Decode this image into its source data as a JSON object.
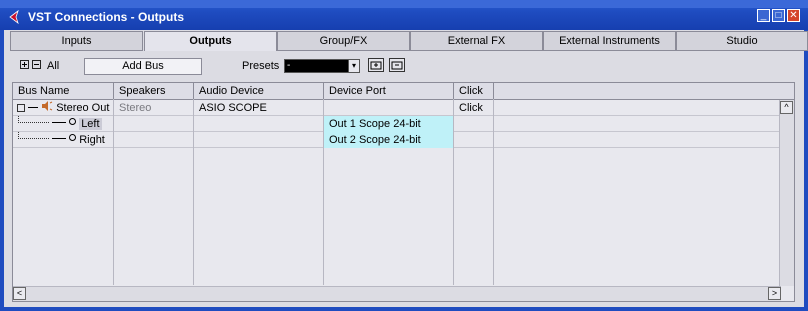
{
  "window": {
    "title": "VST Connections - Outputs",
    "controls": {
      "minimize": "_",
      "restore": "□",
      "close": "✕"
    }
  },
  "tabs": [
    {
      "label": "Inputs",
      "active": false
    },
    {
      "label": "Outputs",
      "active": true
    },
    {
      "label": "Group/FX",
      "active": false
    },
    {
      "label": "External FX",
      "active": false
    },
    {
      "label": "External Instruments",
      "active": false
    },
    {
      "label": "Studio",
      "active": false
    }
  ],
  "toolbar": {
    "all_label": "All",
    "add_bus_label": "Add Bus",
    "presets_label": "Presets",
    "presets_value": "-",
    "dropdown_arrow": "▾"
  },
  "table": {
    "columns": [
      "Bus Name",
      "Speakers",
      "Audio Device",
      "Device Port",
      "Click"
    ],
    "rows": [
      {
        "bus_name": "Stereo Out",
        "speakers": "Stereo",
        "audio_device": "ASIO SCOPE",
        "device_port": "",
        "click": "Click"
      },
      {
        "bus_name": "Left",
        "speakers": "",
        "audio_device": "",
        "device_port": "Out 1 Scope 24-bit",
        "click": ""
      },
      {
        "bus_name": "Right",
        "speakers": "",
        "audio_device": "",
        "device_port": "Out 2 Scope 24-bit",
        "click": ""
      }
    ]
  },
  "scrollbar": {
    "up": "^",
    "left": "<",
    "right": ">"
  },
  "colors": {
    "title_bar": "#1f4cc0",
    "port_highlight": "#bff1f8",
    "logo": "#c8102e"
  }
}
